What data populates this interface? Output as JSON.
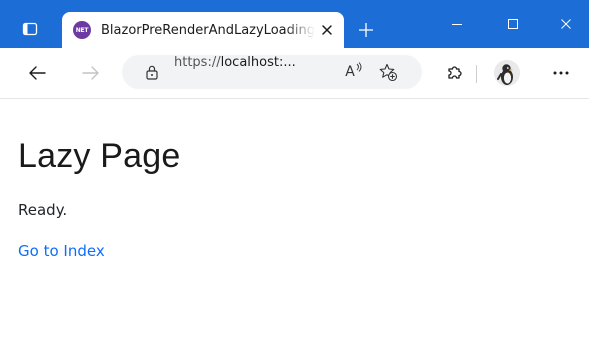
{
  "browser": {
    "tab": {
      "favicon_text": "NET",
      "title": "BlazorPreRenderAndLazyLoading"
    },
    "address": {
      "url_prefix": "https://",
      "url_host": "localhost:..."
    },
    "read_aloud_glyph": "A",
    "colors": {
      "titlebar": "#1c6ed6",
      "favicon": "#6d3aa3",
      "link": "#0d6efd"
    }
  },
  "page": {
    "title": "Lazy Page",
    "status": "Ready.",
    "link_label": "Go to Index"
  }
}
